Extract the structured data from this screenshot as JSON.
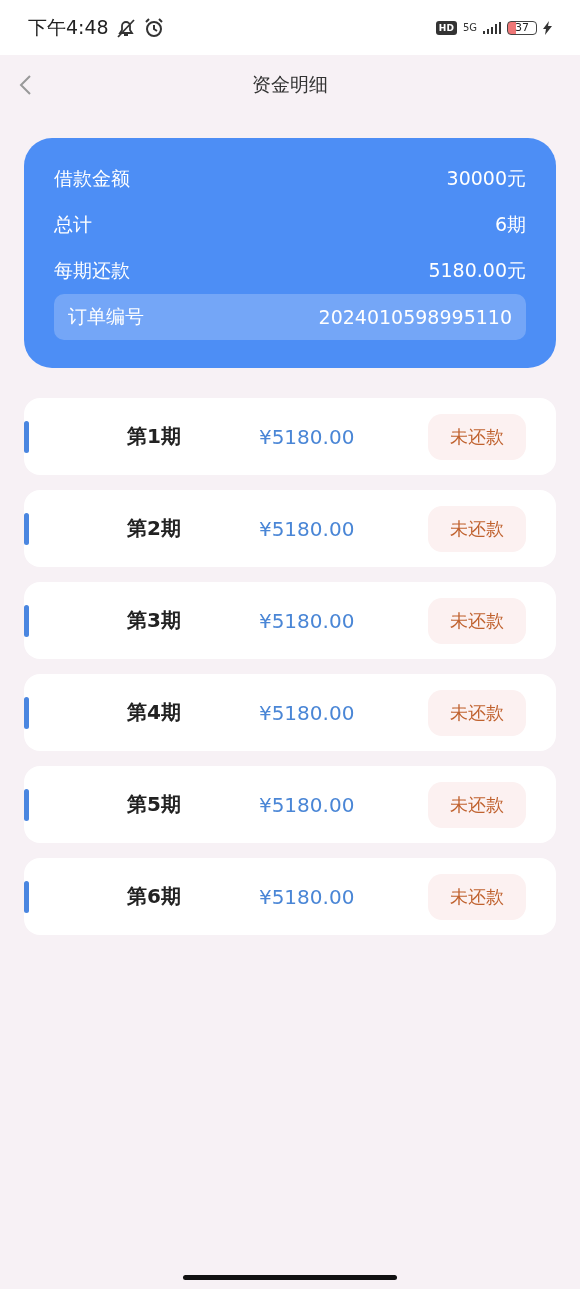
{
  "status_bar": {
    "time": "下午4:48",
    "hd": "HD",
    "network": "5G",
    "battery": "37"
  },
  "nav": {
    "title": "资金明细"
  },
  "summary": {
    "rows": [
      {
        "label": "借款金额",
        "value": "30000元"
      },
      {
        "label": "总计",
        "value": "6期"
      },
      {
        "label": "每期还款",
        "value": "5180.00元"
      }
    ],
    "order": {
      "label": "订单编号",
      "value": "2024010598995110"
    }
  },
  "installments": [
    {
      "period": "第1期",
      "amount": "¥5180.00",
      "status": "未还款",
      "kind": "unpaid"
    },
    {
      "period": "第2期",
      "amount": "¥5180.00",
      "status": "未还款",
      "kind": "unpaid"
    },
    {
      "period": "第3期",
      "amount": "¥5180.00",
      "status": "未还款",
      "kind": "unpaid"
    },
    {
      "period": "第4期",
      "amount": "¥5180.00",
      "status": "未还款",
      "kind": "unpaid"
    },
    {
      "period": "第5期",
      "amount": "¥5180.00",
      "status": "未还款",
      "kind": "unpaid"
    },
    {
      "period": "第6期",
      "amount": "¥5180.00",
      "status": "未还款",
      "kind": "unpaid"
    }
  ]
}
